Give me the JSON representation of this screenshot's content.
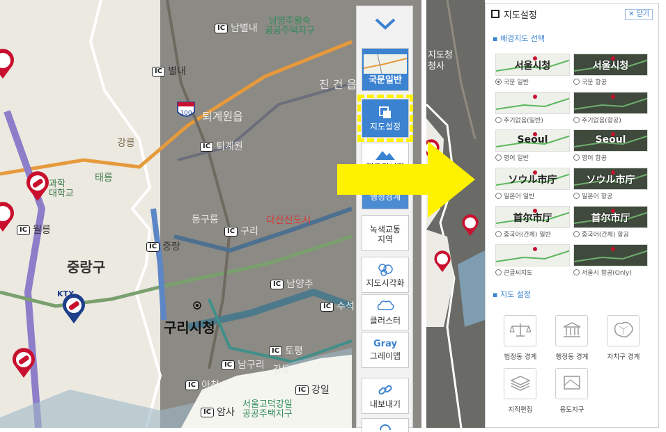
{
  "map_labels": {
    "namyangju_district": "남양주왕숙\n공공주택지구",
    "jingeon": "진 건 읍",
    "toegyewon": "퇴계원읍",
    "gangneung": "강릉",
    "taereung": "태릉",
    "donggureung": "동구릉",
    "dasan": "다산신도시",
    "jungnang": "중랑구",
    "guri_city_hall": "구리시청",
    "seoul_godeok": "서울고덕강일\n공공주택지구",
    "gangdong": "강동",
    "hwagye_univ": "과학\n대학교",
    "ktx": "KTX",
    "ic_nambyeongnae": "남별내",
    "ic_byeollae": "별내",
    "ic_toegyewon": "퇴계원",
    "ic_wolleung": "월릉",
    "ic_jungnang": "중랑",
    "ic_guri": "구리",
    "ic_namyangju": "남양주",
    "ic_susik": "수석",
    "ic_topyeong": "토평",
    "ic_namguri": "남구리",
    "ic_acheon": "아천",
    "ic_amsa": "암사",
    "ic_gangil": "강일",
    "route_100": "100",
    "ic": "IC",
    "right_strip_1": "지도청",
    "right_strip_2": "청사"
  },
  "tools": {
    "basic_map": "국문일반",
    "map_settings": "지도설정",
    "map_aerial": "지도전시관",
    "admin_bound": "행정경계",
    "green_traffic": "녹색교통\n지역",
    "visualization": "지도시각화",
    "cluster": "클러스터",
    "gray_en": "Gray",
    "gray_map": "그레이맵",
    "export": "내보내기"
  },
  "panel": {
    "title": "지도설정",
    "close": "닫기",
    "bg_section": "배경지도 선택",
    "settings_section": "지도 설정",
    "bg_options": [
      {
        "thumb": "서울시청",
        "label": "국문 일반",
        "selected": true
      },
      {
        "thumb": "서울시청",
        "label": "국문 항공",
        "selected": false
      },
      {
        "thumb": "",
        "label": "주기없음(일반)",
        "selected": false
      },
      {
        "thumb": "",
        "label": "주기없음(항공)",
        "selected": false
      },
      {
        "thumb": "Seoul",
        "label": "영어 일반",
        "selected": false
      },
      {
        "thumb": "Seoul",
        "label": "영어 항공",
        "selected": false
      },
      {
        "thumb": "ソウル市庁",
        "label": "일본어 일반",
        "selected": false
      },
      {
        "thumb": "ソウル市庁",
        "label": "일본어 항공",
        "selected": false
      },
      {
        "thumb": "首尔市厅",
        "label": "중국어(간체) 일반",
        "selected": false
      },
      {
        "thumb": "首尔市厅",
        "label": "중국어(간체) 항공",
        "selected": false
      },
      {
        "thumb": "",
        "label": "큰글씨지도",
        "selected": false
      },
      {
        "thumb": "",
        "label": "서울시 항공(Only)",
        "selected": false
      }
    ],
    "settings": [
      {
        "label": "법정동 경계",
        "icon": "scale-icon"
      },
      {
        "label": "행정동 경계",
        "icon": "building-icon"
      },
      {
        "label": "자치구 경계",
        "icon": "district-map-icon"
      },
      {
        "label": "지적편집",
        "icon": "layers-icon"
      },
      {
        "label": "용도지구",
        "icon": "zone-map-icon"
      }
    ]
  },
  "colors": {
    "accent": "#3b82d0",
    "highlight_yellow": "#fff200",
    "pin_red": "#c8102e",
    "pin_blue": "#1e3f8a"
  }
}
